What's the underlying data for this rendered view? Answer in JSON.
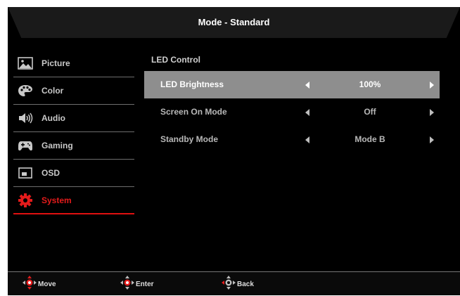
{
  "header": {
    "title": "Mode - Standard"
  },
  "sidebar": {
    "items": [
      {
        "label": "Picture",
        "icon": "picture-icon"
      },
      {
        "label": "Color",
        "icon": "palette-icon"
      },
      {
        "label": "Audio",
        "icon": "speaker-icon"
      },
      {
        "label": "Gaming",
        "icon": "gamepad-icon"
      },
      {
        "label": "OSD",
        "icon": "osd-window-icon"
      },
      {
        "label": "System",
        "icon": "gear-icon",
        "active": true
      }
    ]
  },
  "main": {
    "section_title": "LED Control",
    "rows": [
      {
        "label": "LED Brightness",
        "value": "100%",
        "selected": true
      },
      {
        "label": "Screen On Mode",
        "value": "Off"
      },
      {
        "label": "Standby Mode",
        "value": "Mode B"
      }
    ]
  },
  "footer": {
    "move_label": "Move",
    "enter_label": "Enter",
    "back_label": "Back"
  },
  "colors": {
    "accent": "#e41b1b",
    "selected_row": "#8e8e8e",
    "background": "#000000"
  }
}
